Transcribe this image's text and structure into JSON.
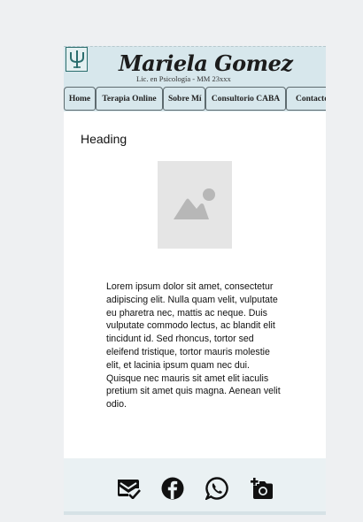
{
  "brand": {
    "name": "Mariela Gomez",
    "subtitle": "Lic. en Psicología - MM 23xxx",
    "logo_icon": "psi-symbol-icon",
    "accent": "#2a6d6d"
  },
  "nav": {
    "items": [
      {
        "label": "Home"
      },
      {
        "label": "Terapia Online"
      },
      {
        "label": "Sobre Mí"
      },
      {
        "label": "Consultorio CABA"
      },
      {
        "label": "Contacto"
      }
    ]
  },
  "main": {
    "heading": "Heading",
    "image_icon": "image-placeholder-icon",
    "body_text": "Lorem ipsum dolor sit amet, consectetur adipiscing elit. Nulla quam velit, vulputate eu pharetra nec, mattis ac neque. Duis vulputate commodo lectus, ac blandit elit tincidunt id. Sed rhoncus, tortor sed eleifend tristique, tortor mauris molestie elit, et lacinia ipsum quam nec dui. Quisque nec mauris sit amet elit iaculis pretium sit amet quis magna. Aenean velit odio."
  },
  "footer": {
    "icons": [
      "mail-check-icon",
      "facebook-icon",
      "whatsapp-icon",
      "add-photo-icon"
    ]
  },
  "colors": {
    "header_bg": "#d7e7ec",
    "page_bg": "#eef0f2",
    "footer_bg": "#eaf1f3"
  }
}
